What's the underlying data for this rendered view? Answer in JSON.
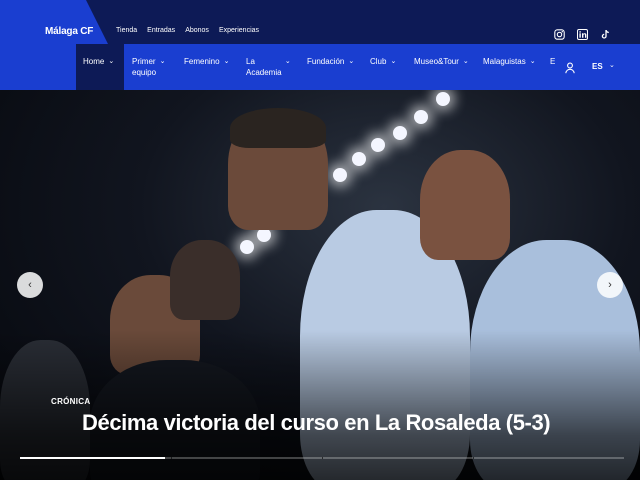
{
  "brand": {
    "name": "Málaga CF"
  },
  "top_links": [
    "Tienda",
    "Entradas",
    "Abonos",
    "Experiencias"
  ],
  "social_icons": [
    "instagram-icon",
    "linkedin-icon",
    "tiktok-icon"
  ],
  "nav": {
    "home": "Home",
    "items": [
      {
        "label_line1": "Primer",
        "label_line2": "equipo"
      },
      {
        "label_line1": "Femenino",
        "label_line2": ""
      },
      {
        "label_line1": "La",
        "label_line2": "Academia"
      },
      {
        "label_line1": "Fundación",
        "label_line2": ""
      },
      {
        "label_line1": "Club",
        "label_line2": ""
      },
      {
        "label_line1": "Museo&Tour",
        "label_line2": ""
      },
      {
        "label_line1": "Malaguistas",
        "label_line2": ""
      },
      {
        "label_line1": "E",
        "label_line2": ""
      }
    ],
    "language": "ES"
  },
  "hero": {
    "kicker": "CRÓNICA",
    "headline": "Décima victoria del curso en La Rosaleda (5-3)",
    "slide_progress": 0.24,
    "slide_count": 4
  },
  "colors": {
    "nav_blue": "#1a3ed0",
    "top_navy": "#0d1a56"
  }
}
